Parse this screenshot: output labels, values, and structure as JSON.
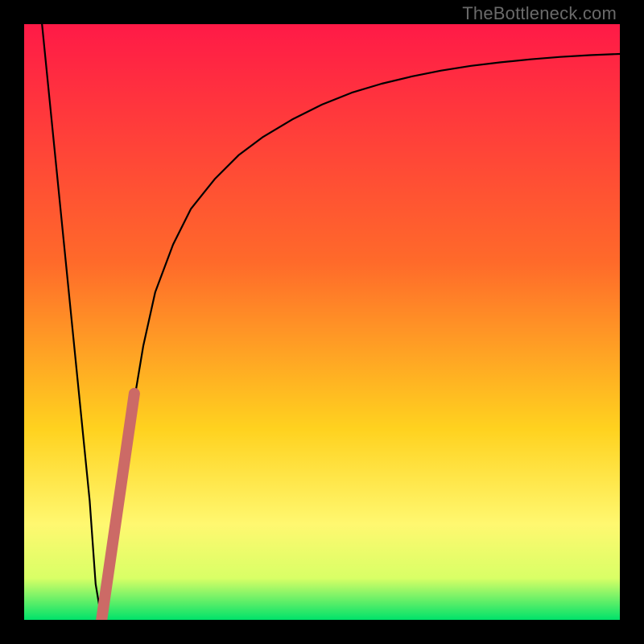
{
  "watermark": {
    "text": "TheBottleneck.com"
  },
  "colors": {
    "top": "#ff1a47",
    "mid1": "#ff6a2a",
    "mid2": "#ffd21f",
    "mid3": "#fff870",
    "mid4": "#d9ff66",
    "bottom": "#00e26a",
    "curve": "#000000",
    "accent": "#cc6a66"
  },
  "chart_data": {
    "type": "line",
    "title": "",
    "xlabel": "",
    "ylabel": "",
    "xlim": [
      0,
      100
    ],
    "ylim": [
      0,
      100
    ],
    "series": [
      {
        "name": "black-curve",
        "x": [
          3,
          5,
          7,
          9,
          11,
          12,
          13,
          14,
          16,
          18,
          20,
          22,
          25,
          28,
          32,
          36,
          40,
          45,
          50,
          55,
          60,
          65,
          70,
          75,
          80,
          85,
          90,
          95,
          100
        ],
        "y": [
          100,
          80,
          60,
          40,
          20,
          6,
          0,
          6,
          20,
          34,
          46,
          55,
          63,
          69,
          74,
          78,
          81,
          84,
          86.5,
          88.5,
          90,
          91.2,
          92.2,
          93,
          93.6,
          94.1,
          94.5,
          94.8,
          95
        ]
      },
      {
        "name": "accent-segment",
        "x": [
          13,
          18.5
        ],
        "y": [
          0,
          38
        ]
      }
    ]
  }
}
